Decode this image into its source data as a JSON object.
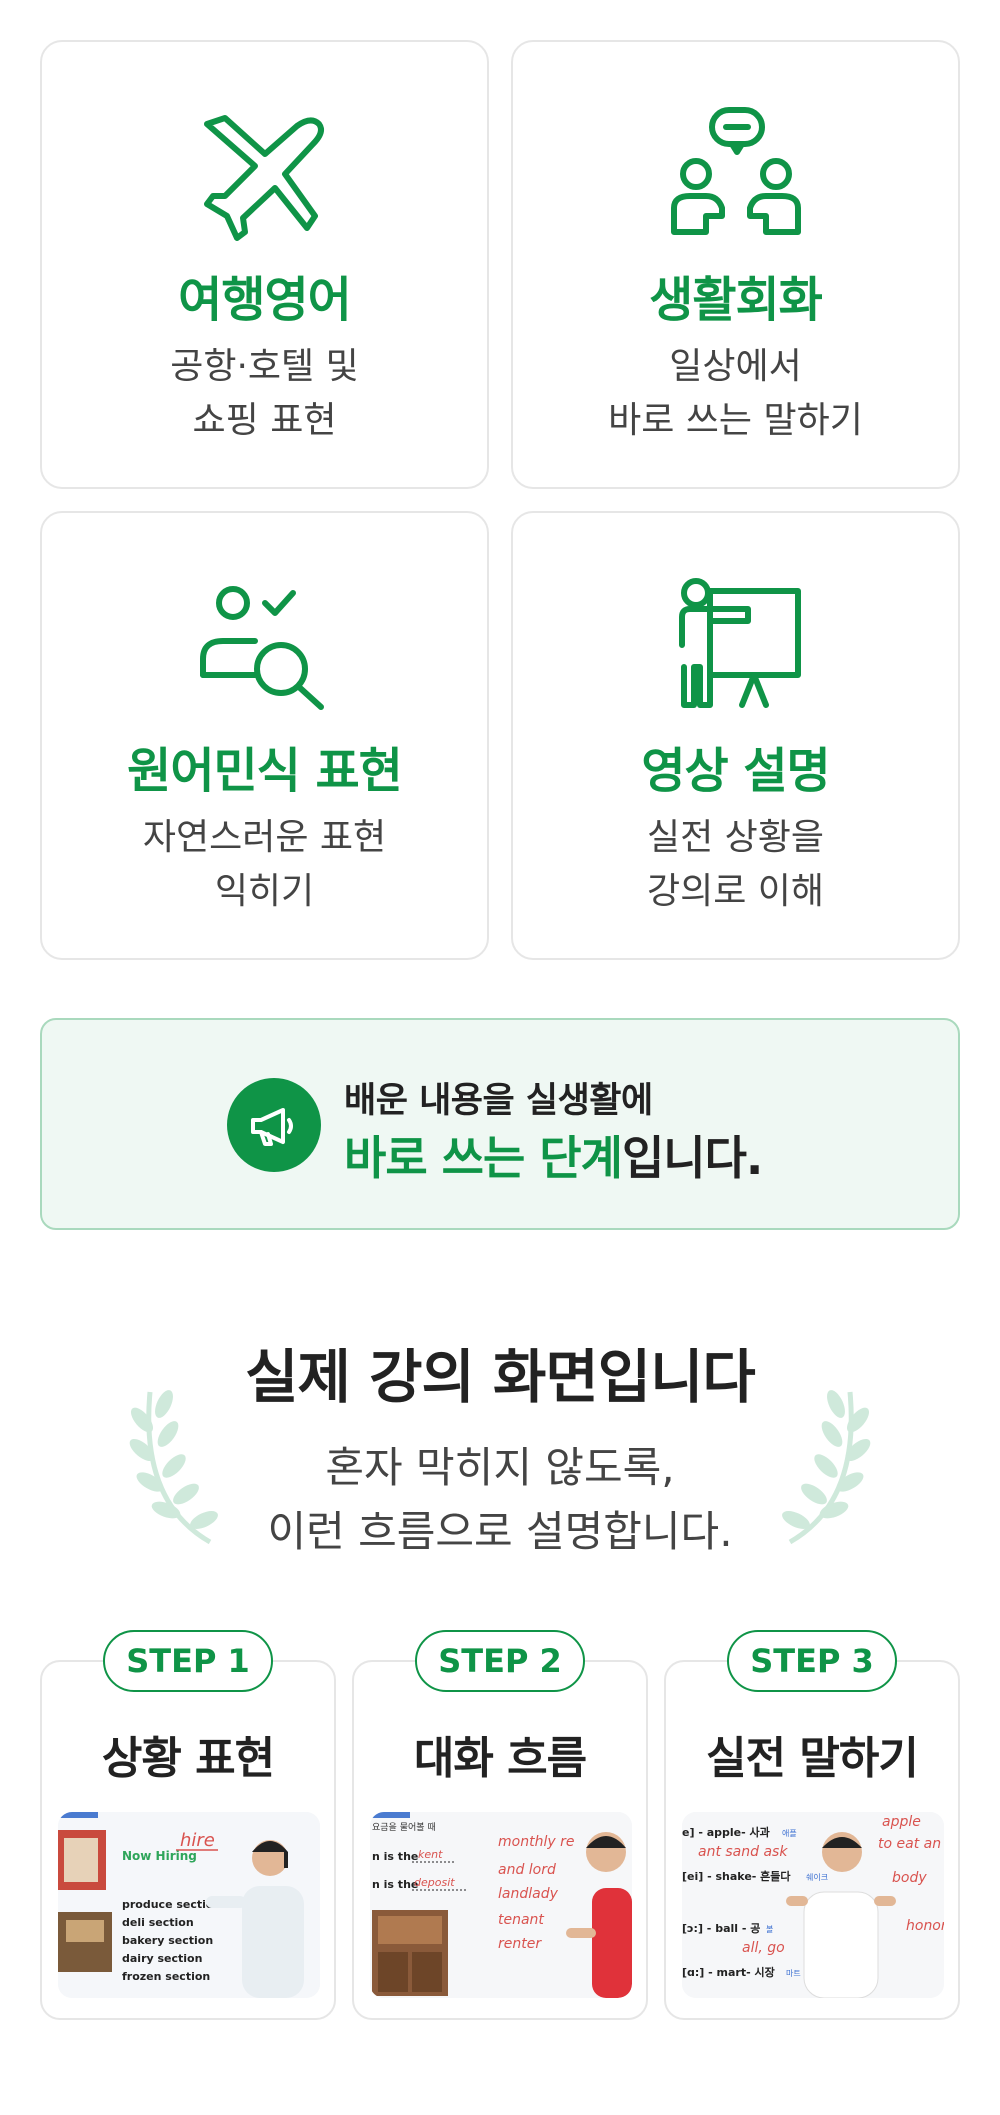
{
  "features": [
    {
      "icon": "airplane-icon",
      "title": "여행영어",
      "desc": [
        "공항·호텔 및",
        "쇼핑 표현"
      ]
    },
    {
      "icon": "conversation-people-icon",
      "title": "생활회화",
      "desc": [
        "일상에서",
        "바로 쓰는 말하기"
      ]
    },
    {
      "icon": "person-search-icon",
      "title": "원어민식 표현",
      "desc": [
        "자연스러운 표현",
        "익히기"
      ]
    },
    {
      "icon": "presenter-board-icon",
      "title": "영상 설명",
      "desc": [
        "실전 상황을",
        "강의로 이해"
      ]
    }
  ],
  "banner": {
    "icon": "megaphone-icon",
    "line1": "배운 내용을 실생활에",
    "line2_highlight": "바로 쓰는 단계",
    "line2_rest": "입니다."
  },
  "lecture": {
    "heading": "실제 강의 화면입니다",
    "sub": [
      "혼자 막히지 않도록,",
      "이런 흐름으로 설명합니다."
    ]
  },
  "steps": [
    {
      "pill": "STEP 1",
      "title": "상황 표현",
      "thumb": {
        "board_word": "hire",
        "heading": "Now Hiring",
        "items": [
          "produce section",
          "deli section",
          "bakery section",
          "dairy section",
          "frozen section"
        ]
      }
    },
    {
      "pill": "STEP 2",
      "title": "대화 흐름",
      "thumb": {
        "caption": "요금을 물어볼 때",
        "lines": [
          "n is the",
          "kent",
          "n is the",
          "deposit"
        ],
        "board": [
          "monthly re",
          "and lord",
          "landlady",
          "tenant",
          "renter"
        ]
      }
    },
    {
      "pill": "STEP 3",
      "title": "실전 말하기",
      "thumb": {
        "rows": [
          "e] - apple- 사과",
          "[ei] - shake- 흔들다",
          "[ɔ:] - ball - 공",
          "[ɑ:] - mart- 시장"
        ],
        "tags": [
          "애플",
          "쉐이크",
          "볼",
          "마트"
        ],
        "board": [
          "ant  sand  ask",
          "apple",
          "to eat an",
          "body",
          "all, go",
          "honor"
        ]
      }
    }
  ],
  "colors": {
    "accent": "#0f9447",
    "banner_bg": "#eff8f3",
    "board_red": "#d9534f"
  }
}
